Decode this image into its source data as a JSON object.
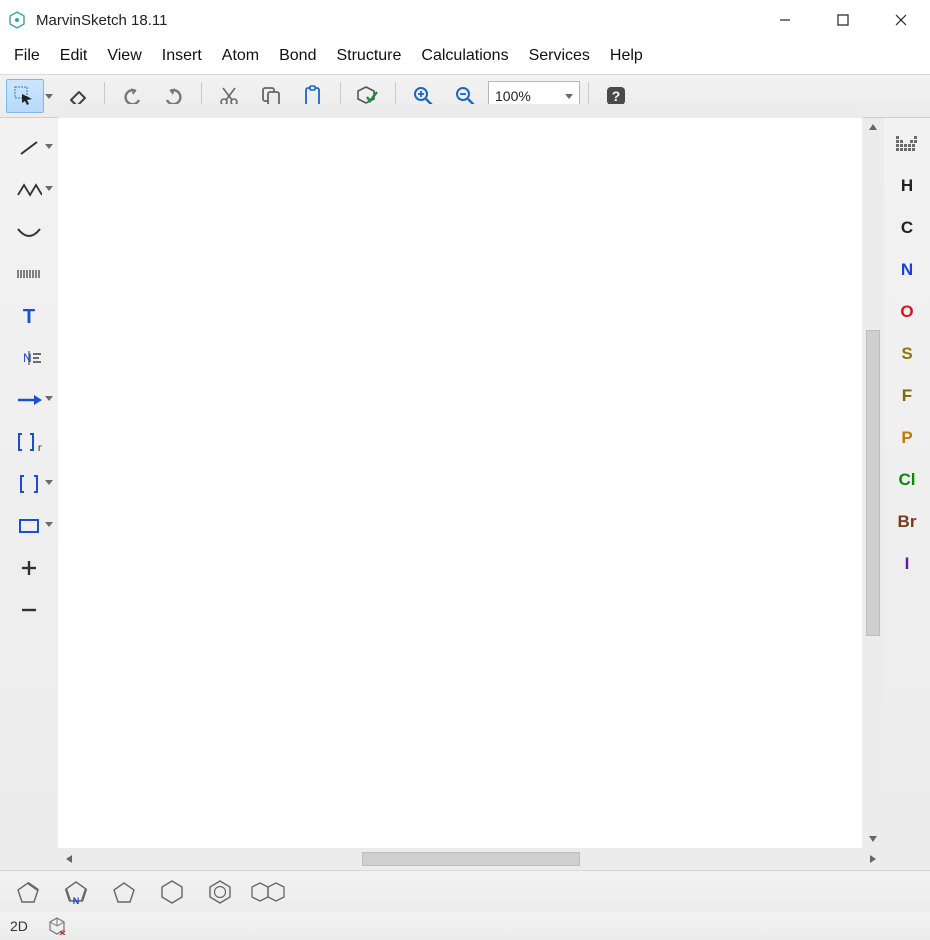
{
  "window": {
    "title": "MarvinSketch 18.11"
  },
  "menu": {
    "items": [
      "File",
      "Edit",
      "View",
      "Insert",
      "Atom",
      "Bond",
      "Structure",
      "Calculations",
      "Services",
      "Help"
    ]
  },
  "toolbar": {
    "zoom_value": "100%"
  },
  "atoms": [
    {
      "sym": "H",
      "color": "#222222"
    },
    {
      "sym": "C",
      "color": "#222222"
    },
    {
      "sym": "N",
      "color": "#1a3fd8"
    },
    {
      "sym": "O",
      "color": "#d11a1a"
    },
    {
      "sym": "S",
      "color": "#8a7a00"
    },
    {
      "sym": "F",
      "color": "#7a6a00"
    },
    {
      "sym": "P",
      "color": "#c07a00"
    },
    {
      "sym": "Cl",
      "color": "#0a8a0a"
    },
    {
      "sym": "Br",
      "color": "#7a3a1a"
    },
    {
      "sym": "I",
      "color": "#6a1a9a"
    }
  ],
  "status": {
    "mode": "2D"
  }
}
